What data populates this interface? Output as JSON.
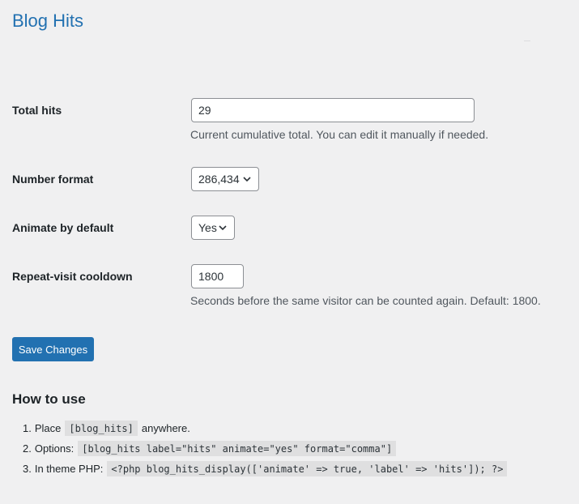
{
  "page": {
    "title": "Blog Hits"
  },
  "form": {
    "total_hits": {
      "label": "Total hits",
      "value": "29",
      "description": "Current cumulative total. You can edit it manually if needed."
    },
    "number_format": {
      "label": "Number format",
      "selected": "286,434"
    },
    "animate": {
      "label": "Animate by default",
      "selected": "Yes"
    },
    "cooldown": {
      "label": "Repeat-visit cooldown",
      "value": "1800",
      "description": "Seconds before the same visitor can be counted again. Default: 1800."
    },
    "save_label": "Save Changes"
  },
  "howto": {
    "title": "How to use",
    "items": [
      {
        "num": "1.",
        "prefix": "Place",
        "code": "[blog_hits]",
        "suffix": "anywhere."
      },
      {
        "num": "2.",
        "prefix": "Options:",
        "code": "[blog_hits label=\"hits\" animate=\"yes\" format=\"comma\"]",
        "suffix": ""
      },
      {
        "num": "3.",
        "prefix": "In theme PHP:",
        "code": "<?php blog_hits_display(['animate' => true, 'label' => 'hits']); ?>",
        "suffix": ""
      }
    ]
  },
  "icons": {
    "select_arrow": "chevron-down-icon"
  }
}
